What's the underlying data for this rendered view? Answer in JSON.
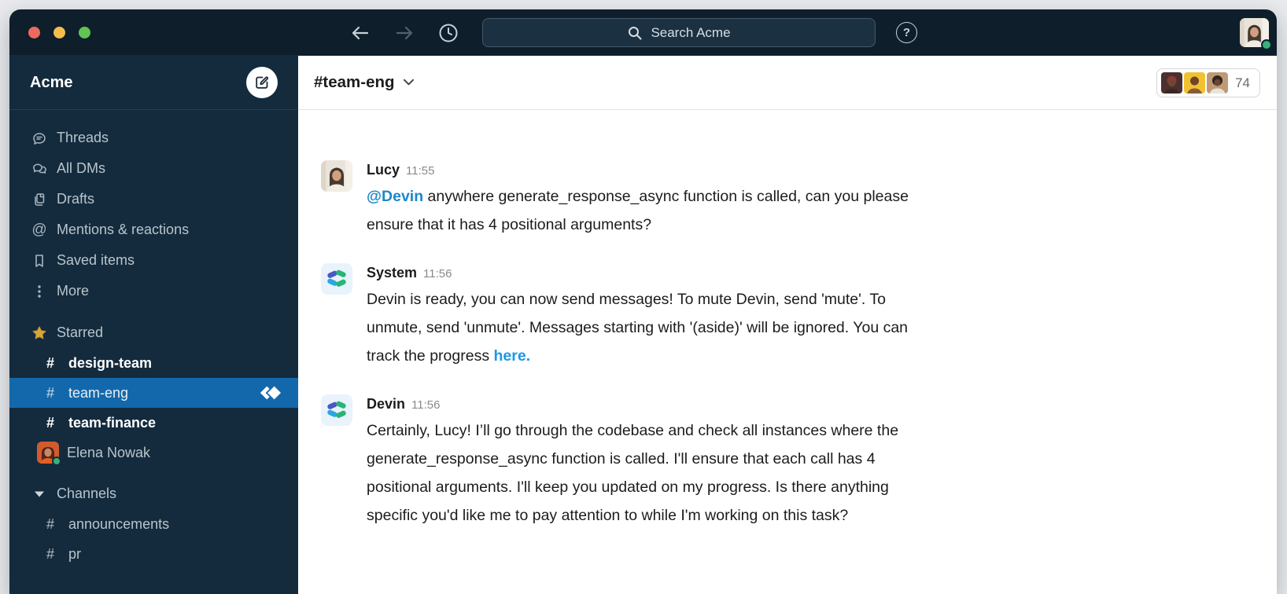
{
  "titlebar": {
    "search_label": "Search Acme",
    "help_label": "?"
  },
  "sidebar": {
    "workspace_name": "Acme",
    "channel_prefix": "#",
    "mentions_glyph": "@",
    "nav": [
      {
        "icon": "threads-icon",
        "label": "Threads"
      },
      {
        "icon": "dms-icon",
        "label": "All DMs"
      },
      {
        "icon": "drafts-icon",
        "label": "Drafts"
      },
      {
        "icon": "mentions-icon",
        "label": "Mentions & reactions"
      },
      {
        "icon": "bookmark-icon",
        "label": "Saved items"
      },
      {
        "icon": "more-icon",
        "label": "More"
      }
    ],
    "starred": {
      "label": "Starred",
      "items": [
        {
          "type": "channel",
          "label": "design-team",
          "unread": true
        },
        {
          "type": "channel",
          "label": "team-eng",
          "selected": true,
          "badge": "devin-logo"
        },
        {
          "type": "channel",
          "label": "team-finance",
          "unread": true
        },
        {
          "type": "dm",
          "label": "Elena Nowak",
          "presence": "online"
        }
      ]
    },
    "channels": {
      "label": "Channels",
      "items": [
        {
          "type": "channel",
          "label": "announcements"
        },
        {
          "type": "channel",
          "label": "pr"
        }
      ]
    }
  },
  "header": {
    "channel_name": "#team-eng",
    "member_count": "74"
  },
  "messages": [
    {
      "author": "Lucy",
      "time": "11:55",
      "avatar": "lucy",
      "mention": "@Devin",
      "lines": [
        "anywhere generate_response_async function is called, can you please",
        "ensure that it has 4 positional arguments?"
      ]
    },
    {
      "author": "System",
      "time": "11:56",
      "avatar": "devin-logo",
      "lines": [
        "Devin is ready, you can now send messages! To mute Devin, send 'mute'. To",
        "unmute, send 'unmute'. Messages starting with '(aside)' will be ignored. You can",
        "track the progress"
      ],
      "link": "here."
    },
    {
      "author": "Devin",
      "time": "11:56",
      "avatar": "devin-logo",
      "lines": [
        "Certainly, Lucy! I’ll go through the codebase and check all instances where the",
        "generate_response_async function is called. I'll ensure that each call has 4",
        "positional arguments. I'll keep you updated on my progress. Is there anything",
        "specific you'd like me to pay attention to while I'm working on this task?"
      ]
    }
  ],
  "colors": {
    "titlebar_bg": "#0e1f2b",
    "sidebar_bg": "#132b3d",
    "selected_channel_bg": "#1368ab",
    "mention_blue": "#1d87c9",
    "link_blue": "#189ae3",
    "presence_green": "#36b27a",
    "unread_white": "#ffffff",
    "message_text": "#1d1c1d"
  }
}
